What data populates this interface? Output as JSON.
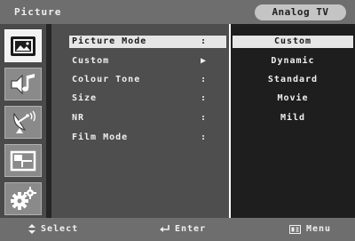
{
  "header": {
    "title": "Picture",
    "source": "Analog TV"
  },
  "sidebar": {
    "items": [
      {
        "icon": "picture-icon",
        "active": true
      },
      {
        "icon": "sound-icon",
        "active": false
      },
      {
        "icon": "channel-icon",
        "active": false
      },
      {
        "icon": "setup-icon",
        "active": false
      },
      {
        "icon": "settings-icon",
        "active": false
      }
    ]
  },
  "menu": {
    "items": [
      {
        "label": "Picture Mode",
        "marker": ":"
      },
      {
        "label": "Custom",
        "marker": "▶"
      },
      {
        "label": "Colour Tone",
        "marker": ":"
      },
      {
        "label": "Size",
        "marker": ":"
      },
      {
        "label": "NR",
        "marker": ":"
      },
      {
        "label": "Film Mode",
        "marker": ":"
      }
    ]
  },
  "options": {
    "items": [
      "Custom",
      "Dynamic",
      "Standard",
      "Movie",
      "Mild"
    ]
  },
  "footer": {
    "select": {
      "icon": "updown-icon",
      "label": "Select"
    },
    "enter": {
      "icon": "enter-icon",
      "label": "Enter"
    },
    "menu": {
      "icon": "menu-icon",
      "label": "Menu"
    }
  },
  "colors": {
    "bar": "#6e6e6e",
    "highlight": "#e6e6e6",
    "panel": "#4e4e4e",
    "values_panel": "#1e1e1e"
  }
}
